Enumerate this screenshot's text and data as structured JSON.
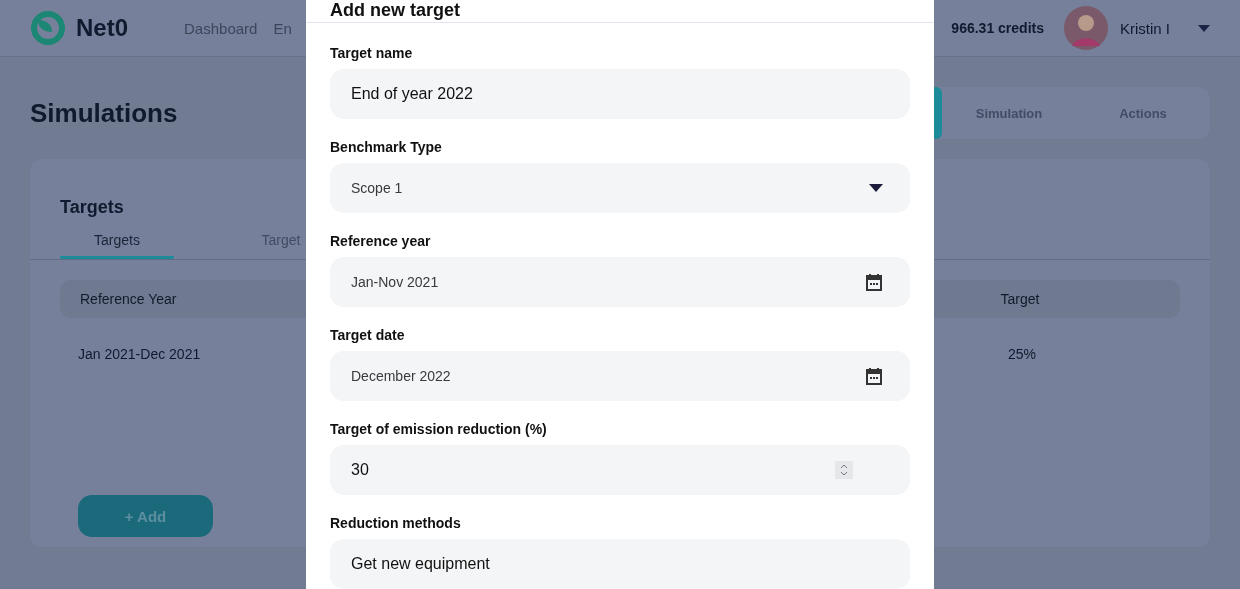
{
  "header": {
    "logo": "Net0",
    "nav": [
      {
        "label": "Dashboard"
      },
      {
        "label": "En"
      }
    ],
    "credits": "966.31 credits",
    "user": {
      "name": "Kristin I"
    }
  },
  "page": {
    "title": "Simulations",
    "view_tabs": [
      {
        "selected": true
      },
      {
        "label": "Simulation",
        "selected": false
      },
      {
        "label": "Actions",
        "selected": false
      }
    ]
  },
  "card": {
    "title": "Targets",
    "tabs": [
      {
        "label": "Targets",
        "selected": true
      },
      {
        "label": "Target",
        "selected": false
      }
    ],
    "table": {
      "columns": [
        "Reference Year",
        "Target"
      ],
      "rows": [
        [
          "Jan 2021-Dec 2021",
          "25%"
        ]
      ]
    },
    "add_button": "+ Add"
  },
  "modal": {
    "title": "Add new target",
    "fields": [
      {
        "label": "Target name",
        "kind": "text",
        "value": "End of year 2022"
      },
      {
        "label": "Benchmark Type",
        "kind": "select",
        "value": "Scope 1"
      },
      {
        "label": "Reference year",
        "kind": "date",
        "value": "Jan-Nov 2021"
      },
      {
        "label": "Target date",
        "kind": "date",
        "value": "December 2022"
      },
      {
        "label": "Target of emission reduction (%)",
        "kind": "number",
        "value": "30"
      },
      {
        "label": "Reduction methods",
        "kind": "text",
        "value": "Get new equipment"
      }
    ]
  }
}
